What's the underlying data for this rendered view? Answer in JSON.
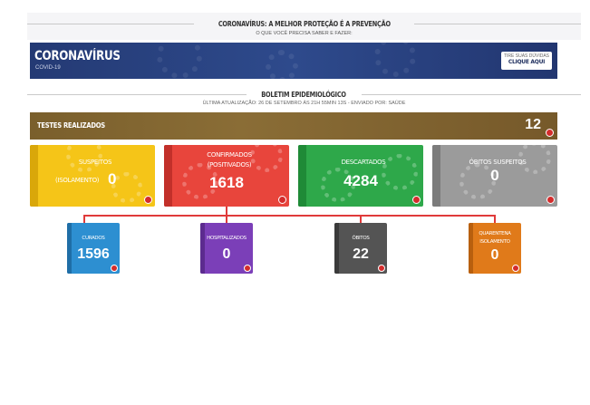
{
  "header": {
    "title": "CORONAVÍRUS: A MELHOR PROTEÇÃO É A PREVENÇÃO",
    "subtitle": "O QUE VOCÊ PRECISA SABER E FAZER:"
  },
  "banner": {
    "title": "CORONAVÍRUS",
    "subtitle": "COVID-19",
    "doubt_line1": "TIRE SUAS DÚVIDAS",
    "doubt_line2": "CLIQUE AQUI"
  },
  "bulletin": {
    "title": "BOLETIM EPIDEMIOLÓGICO",
    "update": "ÚLTIMA ATUALIZAÇÃO: 26 DE SETEMBRO ÀS 21H 55MIN 13S - ENVIADO POR: SAÚDE"
  },
  "tests": {
    "label": "TESTES REALIZADOS",
    "value": "12"
  },
  "cards": [
    {
      "label1": "SUSPEITOS",
      "label2": "(ISOLAMENTO)",
      "value": "0",
      "color": "#f5c518",
      "edge": "#d9a70a"
    },
    {
      "label1": "CONFIRMADOS",
      "label2": "(POSITIVADOS)",
      "value": "1618",
      "color": "#e8453c",
      "edge": "#c2302a"
    },
    {
      "label1": "DESCARTADOS",
      "label2": "",
      "value": "4284",
      "color": "#2ea84a",
      "edge": "#1f8a37"
    },
    {
      "label1": "ÓBITOS SUSPEITOS",
      "label2": "",
      "value": "0",
      "color": "#9b9b9b",
      "edge": "#7c7c7c"
    }
  ],
  "small_cards": [
    {
      "label1": "CURADOS",
      "label2": "",
      "value": "1596",
      "color": "#2d8fd1",
      "edge": "#1f6ea6"
    },
    {
      "label1": "HOSPITALIZADOS",
      "label2": "",
      "value": "0",
      "color": "#7b3fb8",
      "edge": "#5c2b8f"
    },
    {
      "label1": "ÓBITOS",
      "label2": "",
      "value": "22",
      "color": "#545454",
      "edge": "#3a3a3a"
    },
    {
      "label1": "QUARENTENA",
      "label2": "ISOLAMENTO",
      "value": "0",
      "color": "#e07a1a",
      "edge": "#b85f0e"
    }
  ]
}
